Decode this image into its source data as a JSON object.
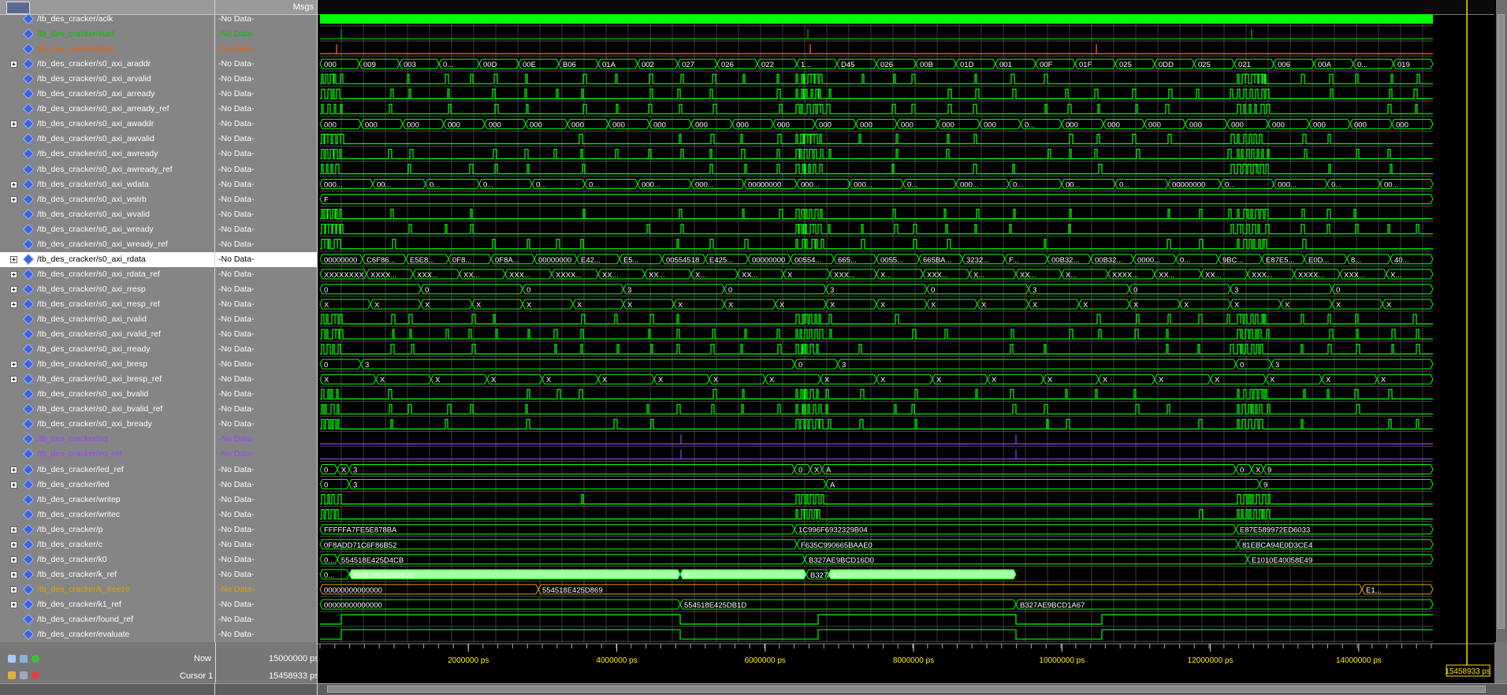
{
  "colors": {
    "wave_green": "#00ff00",
    "start_green": "#00c000",
    "stop_orange": "#ff5a00",
    "irq_purple": "#a040ff",
    "freeze_gold": "#e0a000",
    "cursor_yellow": "#ffe000",
    "bus_fill": "#a8ffa8"
  },
  "header": {
    "msgs_label": "Msgs",
    "toolbar_icon": "wave-window-icon"
  },
  "signals": [
    {
      "name": "/tb_des_cracker/aclk",
      "msg": "-No Data-",
      "expandable": false,
      "color": "white"
    },
    {
      "name": "/tb_des_cracker/start",
      "msg": "-No Data-",
      "expandable": false,
      "color": "green"
    },
    {
      "name": "/tb_des_cracker/stop",
      "msg": "-No Data-",
      "expandable": false,
      "color": "orange"
    },
    {
      "name": "/tb_des_cracker/s0_axi_araddr",
      "msg": "-No Data-",
      "expandable": true,
      "color": "white"
    },
    {
      "name": "/tb_des_cracker/s0_axi_arvalid",
      "msg": "-No Data-",
      "expandable": false,
      "color": "white"
    },
    {
      "name": "/tb_des_cracker/s0_axi_arready",
      "msg": "-No Data-",
      "expandable": false,
      "color": "white"
    },
    {
      "name": "/tb_des_cracker/s0_axi_arready_ref",
      "msg": "-No Data-",
      "expandable": false,
      "color": "white"
    },
    {
      "name": "/tb_des_cracker/s0_axi_awaddr",
      "msg": "-No Data-",
      "expandable": true,
      "color": "white"
    },
    {
      "name": "/tb_des_cracker/s0_axi_awvalid",
      "msg": "-No Data-",
      "expandable": false,
      "color": "white"
    },
    {
      "name": "/tb_des_cracker/s0_axi_awready",
      "msg": "-No Data-",
      "expandable": false,
      "color": "white"
    },
    {
      "name": "/tb_des_cracker/s0_axi_awready_ref",
      "msg": "-No Data-",
      "expandable": false,
      "color": "white"
    },
    {
      "name": "/tb_des_cracker/s0_axi_wdata",
      "msg": "-No Data-",
      "expandable": true,
      "color": "white"
    },
    {
      "name": "/tb_des_cracker/s0_axi_wstrb",
      "msg": "-No Data-",
      "expandable": true,
      "color": "white"
    },
    {
      "name": "/tb_des_cracker/s0_axi_wvalid",
      "msg": "-No Data-",
      "expandable": false,
      "color": "white"
    },
    {
      "name": "/tb_des_cracker/s0_axi_wready",
      "msg": "-No Data-",
      "expandable": false,
      "color": "white"
    },
    {
      "name": "/tb_des_cracker/s0_axi_wready_ref",
      "msg": "-No Data-",
      "expandable": false,
      "color": "white"
    },
    {
      "name": "/tb_des_cracker/s0_axi_rdata",
      "msg": "-No Data-",
      "expandable": true,
      "color": "white",
      "selected": true
    },
    {
      "name": "/tb_des_cracker/s0_axi_rdata_ref",
      "msg": "-No Data-",
      "expandable": true,
      "color": "white"
    },
    {
      "name": "/tb_des_cracker/s0_axi_rresp",
      "msg": "-No Data-",
      "expandable": true,
      "color": "white"
    },
    {
      "name": "/tb_des_cracker/s0_axi_rresp_ref",
      "msg": "-No Data-",
      "expandable": true,
      "color": "white"
    },
    {
      "name": "/tb_des_cracker/s0_axi_rvalid",
      "msg": "-No Data-",
      "expandable": false,
      "color": "white"
    },
    {
      "name": "/tb_des_cracker/s0_axi_rvalid_ref",
      "msg": "-No Data-",
      "expandable": false,
      "color": "white"
    },
    {
      "name": "/tb_des_cracker/s0_axi_rready",
      "msg": "-No Data-",
      "expandable": false,
      "color": "white"
    },
    {
      "name": "/tb_des_cracker/s0_axi_bresp",
      "msg": "-No Data-",
      "expandable": true,
      "color": "white"
    },
    {
      "name": "/tb_des_cracker/s0_axi_bresp_ref",
      "msg": "-No Data-",
      "expandable": true,
      "color": "white"
    },
    {
      "name": "/tb_des_cracker/s0_axi_bvalid",
      "msg": "-No Data-",
      "expandable": false,
      "color": "white"
    },
    {
      "name": "/tb_des_cracker/s0_axi_bvalid_ref",
      "msg": "-No Data-",
      "expandable": false,
      "color": "white"
    },
    {
      "name": "/tb_des_cracker/s0_axi_bready",
      "msg": "-No Data-",
      "expandable": false,
      "color": "white"
    },
    {
      "name": "/tb_des_cracker/irq",
      "msg": "-No Data-",
      "expandable": false,
      "color": "purple"
    },
    {
      "name": "/tb_des_cracker/irq_ref",
      "msg": "-No Data-",
      "expandable": false,
      "color": "purple"
    },
    {
      "name": "/tb_des_cracker/led_ref",
      "msg": "-No Data-",
      "expandable": true,
      "color": "white"
    },
    {
      "name": "/tb_des_cracker/led",
      "msg": "-No Data-",
      "expandable": true,
      "color": "white"
    },
    {
      "name": "/tb_des_cracker/writep",
      "msg": "-No Data-",
      "expandable": false,
      "color": "white"
    },
    {
      "name": "/tb_des_cracker/writec",
      "msg": "-No Data-",
      "expandable": false,
      "color": "white"
    },
    {
      "name": "/tb_des_cracker/p",
      "msg": "-No Data-",
      "expandable": true,
      "color": "white"
    },
    {
      "name": "/tb_des_cracker/c",
      "msg": "-No Data-",
      "expandable": true,
      "color": "white"
    },
    {
      "name": "/tb_des_cracker/k0",
      "msg": "-No Data-",
      "expandable": true,
      "color": "white"
    },
    {
      "name": "/tb_des_cracker/k_ref",
      "msg": "-No Data-",
      "expandable": true,
      "color": "white"
    },
    {
      "name": "/tb_des_cracker/k_freeze",
      "msg": "-No Data-",
      "expandable": true,
      "color": "gold"
    },
    {
      "name": "/tb_des_cracker/k1_ref",
      "msg": "-No Data-",
      "expandable": true,
      "color": "white"
    },
    {
      "name": "/tb_des_cracker/found_ref",
      "msg": "-No Data-",
      "expandable": false,
      "color": "white"
    },
    {
      "name": "/tb_des_cracker/evaluate",
      "msg": "-No Data-",
      "expandable": false,
      "color": "white"
    }
  ],
  "bus_labels": {
    "araddr": [
      "000",
      "009",
      "003",
      "0...",
      "00D",
      "00E",
      "B06",
      "01A",
      "002",
      "027",
      "026",
      "022",
      "1...",
      "D45",
      "026",
      "00B",
      "01D",
      "001",
      "00F",
      "01F",
      "025",
      "0DD",
      "025",
      "021",
      "006",
      "00A",
      "0...",
      "019"
    ],
    "awaddr": [
      "000",
      "000",
      "000",
      "000",
      "000",
      "000",
      "000",
      "000",
      "000",
      "000",
      "000",
      "000",
      "000",
      "000",
      "000",
      "000",
      "000",
      "0...",
      "000",
      "000",
      "000",
      "000",
      "000",
      "000",
      "000",
      "000",
      "000"
    ],
    "wdata": [
      "000...",
      "00...",
      "0...",
      "0...",
      "0...",
      "0...",
      "000...",
      "000...",
      "00000000",
      "000...",
      "000...",
      "0...",
      "000...",
      "0...",
      "00...",
      "0...",
      "00000000",
      "0...",
      "000...",
      "0...",
      "00..."
    ],
    "wstrb": [
      "F"
    ],
    "rdata": [
      "00000000",
      "C6F86...",
      "E5E8...",
      "0F8...",
      "0F8A...",
      "00000000",
      "E42...",
      "E5...",
      "00554518",
      "E425...",
      "00000000",
      "00554...",
      "665...",
      "0055...",
      "665BA...",
      "3232...",
      "F...",
      "00B32...",
      "00B32...",
      "0000...",
      "0...",
      "9BC...",
      "E87E5...",
      "E0D...",
      "8...",
      "40..."
    ],
    "rdata_ref": [
      "XXXXXXXX",
      "XXXX...",
      "XXX...",
      "XX...",
      "XXX...",
      "XXXX...",
      "XX...",
      "XX...",
      "X...",
      "XX...",
      "X",
      "XXX...",
      "X...",
      "XXX...",
      "X...",
      "XX...",
      "X...",
      "XXXX...",
      "XX...",
      "XX...",
      "XXX...",
      "XXXX...",
      "XXX...",
      "X..."
    ],
    "rresp": [
      "0",
      "0",
      "0",
      "3",
      "0",
      "3",
      "0",
      "3",
      "0",
      "3",
      "0"
    ],
    "rresp_ref": [
      "X",
      "X",
      "X",
      "X",
      "X",
      "X",
      "X",
      "X",
      "X",
      "X",
      "X",
      "X",
      "X",
      "X",
      "X",
      "X",
      "X",
      "X",
      "X",
      "X",
      "X",
      "X"
    ],
    "bresp": [
      "0",
      "3",
      "0",
      "3",
      "0",
      "3"
    ],
    "bresp_ref": [
      "X",
      "X",
      "X",
      "X",
      "X",
      "X",
      "X",
      "X",
      "X",
      "X",
      "X",
      "X",
      "X",
      "X",
      "X",
      "X",
      "X",
      "X",
      "X",
      "X"
    ],
    "led_ref": [
      "0",
      "X",
      "3",
      "0",
      "X",
      "A",
      "0",
      "X",
      "9"
    ],
    "led": [
      "0",
      "3",
      "A",
      "9"
    ],
    "p": [
      "FFFFFA7FE5E878BA",
      "1C996F6932329B04",
      "E87E589972ED6033"
    ],
    "c": [
      "0F8ADD71C6F86B52",
      "F635C990665BAAE0",
      "81EBCA94E0D3CE4"
    ],
    "k0": [
      "0...",
      "554518E425D4CB",
      "B327AE9BCD16D0",
      "E1010E40058E49"
    ],
    "k_ref": [
      "0...",
      "554518E425DB21",
      "X...",
      "B327AE9BCD1A6B",
      "X..."
    ],
    "k_freeze": [
      "00000000000000",
      "554518E425D869",
      "E1..."
    ],
    "k1_ref": [
      "00000000000000",
      "554518E425DB1D",
      "B327AE9BCD1A67"
    ]
  },
  "timeline": {
    "ticks": [
      "2000000 ps",
      "4000000 ps",
      "6000000 ps",
      "8000000 ps",
      "10000000 ps",
      "12000000 ps",
      "14000000 ps"
    ],
    "tick_values_ps": [
      2000000,
      4000000,
      6000000,
      8000000,
      10000000,
      12000000,
      14000000
    ],
    "range_ps": [
      0,
      15000000
    ]
  },
  "cursor": {
    "time_ps": 15458933,
    "label": "15458933 ps"
  },
  "status": {
    "now_label": "Now",
    "now_value": "15000000 ps",
    "cursor_label": "Cursor 1",
    "cursor_value": "15458933 ps"
  }
}
